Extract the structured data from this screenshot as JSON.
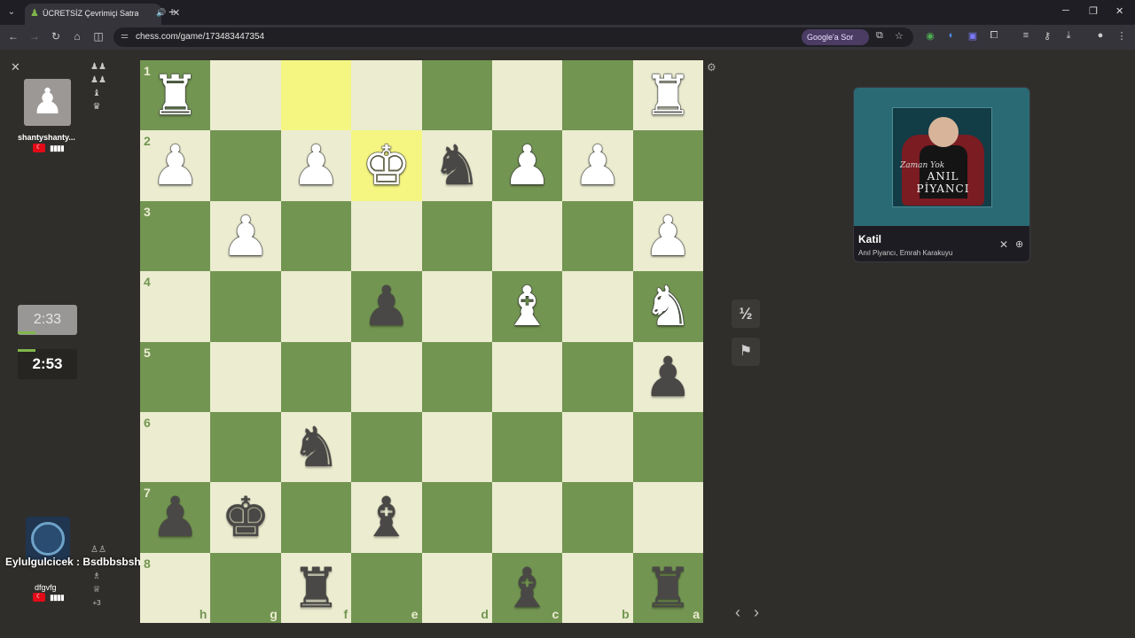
{
  "browser": {
    "tab": {
      "title": "ÜCRETSİZ Çevrimiçi Satranç",
      "favicon": "pawn-icon",
      "audio_icon": "🔊",
      "close": "✕"
    },
    "new_tab": "+",
    "window_controls": {
      "minimize": "─",
      "restore": "❐",
      "close": "✕"
    },
    "url": "chess.com/game/173483447354",
    "google_sor": "Google'a Sor",
    "tab_list_icon": "⌄"
  },
  "game": {
    "top_player": {
      "name": "shantyshanty...",
      "country": "TR",
      "signal": "▮▮▮▮",
      "clock": "2:33",
      "captured": [
        "♟♟",
        "♟♟",
        "♝",
        "♛"
      ]
    },
    "bottom_player": {
      "name": "dfgvfg",
      "country": "TR",
      "signal": "▮▮▮▮",
      "clock": "2:53",
      "captured": [
        "♙♙",
        "♘",
        "♗",
        "♕"
      ],
      "captured_extra": "+3"
    },
    "chat_message": "Eylulgulcicek : Bsdbbsbshsahs",
    "draw_label": "½",
    "resign_icon": "⚑",
    "prev_label": "‹",
    "next_label": "›",
    "settings_icon": "⚙",
    "close_panel": "✕",
    "ranks": [
      "1",
      "2",
      "3",
      "4",
      "5",
      "6",
      "7",
      "8"
    ],
    "files": [
      "h",
      "g",
      "f",
      "e",
      "d",
      "c",
      "b",
      "a"
    ],
    "highlighted_squares": [
      [
        0,
        2
      ],
      [
        1,
        3
      ]
    ],
    "pieces": [
      {
        "row": 0,
        "col": 0,
        "glyph": "♜",
        "color": "white"
      },
      {
        "row": 0,
        "col": 7,
        "glyph": "♜",
        "color": "white"
      },
      {
        "row": 1,
        "col": 0,
        "glyph": "♟",
        "color": "white"
      },
      {
        "row": 1,
        "col": 2,
        "glyph": "♟",
        "color": "white"
      },
      {
        "row": 1,
        "col": 3,
        "glyph": "♚",
        "color": "white"
      },
      {
        "row": 1,
        "col": 4,
        "glyph": "♞",
        "color": "black"
      },
      {
        "row": 1,
        "col": 5,
        "glyph": "♟",
        "color": "white"
      },
      {
        "row": 1,
        "col": 6,
        "glyph": "♟",
        "color": "white"
      },
      {
        "row": 2,
        "col": 1,
        "glyph": "♟",
        "color": "white"
      },
      {
        "row": 2,
        "col": 7,
        "glyph": "♟",
        "color": "white"
      },
      {
        "row": 3,
        "col": 3,
        "glyph": "♟",
        "color": "black"
      },
      {
        "row": 3,
        "col": 5,
        "glyph": "♝",
        "color": "white"
      },
      {
        "row": 3,
        "col": 7,
        "glyph": "♞",
        "color": "white"
      },
      {
        "row": 4,
        "col": 7,
        "glyph": "♟",
        "color": "black"
      },
      {
        "row": 5,
        "col": 2,
        "glyph": "♞",
        "color": "black"
      },
      {
        "row": 6,
        "col": 0,
        "glyph": "♟",
        "color": "black"
      },
      {
        "row": 6,
        "col": 1,
        "glyph": "♚",
        "color": "black"
      },
      {
        "row": 6,
        "col": 3,
        "glyph": "♝",
        "color": "black"
      },
      {
        "row": 7,
        "col": 2,
        "glyph": "♜",
        "color": "black"
      },
      {
        "row": 7,
        "col": 5,
        "glyph": "♝",
        "color": "black"
      },
      {
        "row": 7,
        "col": 7,
        "glyph": "♜",
        "color": "black"
      }
    ]
  },
  "media": {
    "title": "Katil",
    "artist": "Anıl Piyancı, Emrah Karakuyu",
    "album_script": "Zaman Yok",
    "album_artist": "ANIL PİYANCI",
    "close": "✕",
    "more": "⊕"
  },
  "colors": {
    "light_square": "#ebecd0",
    "dark_square": "#739552",
    "highlight": "#f5f682",
    "accent": "#81b64c"
  }
}
